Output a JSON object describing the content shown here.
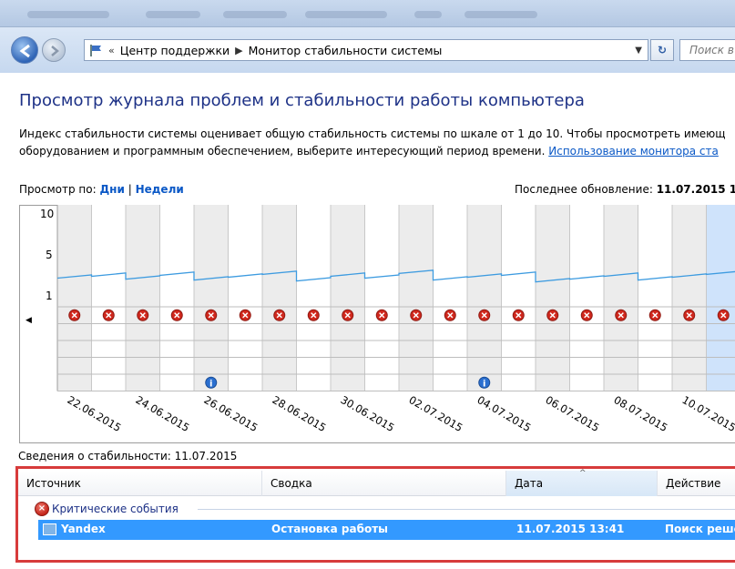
{
  "window": {
    "breadcrumb": [
      "Центр поддержки",
      "Монитор стабильности системы"
    ],
    "breadcrumb_prefix": "«",
    "search_placeholder": "Поиск в"
  },
  "page": {
    "title": "Просмотр журнала проблем и стабильности работы компьютера",
    "intro_line1": "Индекс стабильности системы оценивает общую стабильность системы по шкале от 1 до 10. Чтобы просмотреть имеющ",
    "intro_line2": "оборудованием и программным обеспечением, выберите интересующий период времени.",
    "intro_link": "Использование монитора ста",
    "view_by_label": "Просмотр по:",
    "view_days": "Дни",
    "view_sep": "|",
    "view_weeks": "Недели",
    "last_update_label": "Последнее обновление:",
    "last_update_value": "11.07.2015 1"
  },
  "chart_data": {
    "type": "line",
    "title": "",
    "y_ticks": [
      "10",
      "5",
      "1"
    ],
    "ylim": [
      1,
      10
    ],
    "x_labels": [
      "22.06.2015",
      "24.06.2015",
      "26.06.2015",
      "28.06.2015",
      "30.06.2015",
      "02.07.2015",
      "04.07.2015",
      "06.07.2015",
      "08.07.2015",
      "10.07.2015"
    ],
    "stability_index": [
      3.1,
      3.3,
      3.0,
      3.4,
      2.9,
      3.2,
      3.5,
      2.8,
      3.3,
      3.1,
      3.6,
      2.9,
      3.2,
      3.4,
      2.7,
      3.0,
      3.3,
      2.9,
      3.2,
      3.5
    ],
    "critical_errors_per_day": 20,
    "info_events_days": [
      4,
      12
    ],
    "highlight_color": "#cfe3fb",
    "line_color": "#3d9be0"
  },
  "details": {
    "header": "Сведения о стабильности: 11.07.2015",
    "columns": [
      "Источник",
      "Сводка",
      "Дата",
      "Действие"
    ],
    "group_label": "Критические события",
    "rows": [
      {
        "source": "Yandex",
        "summary": "Остановка работы",
        "date": "11.07.2015 13:41",
        "action": "Поиск реше"
      }
    ]
  }
}
